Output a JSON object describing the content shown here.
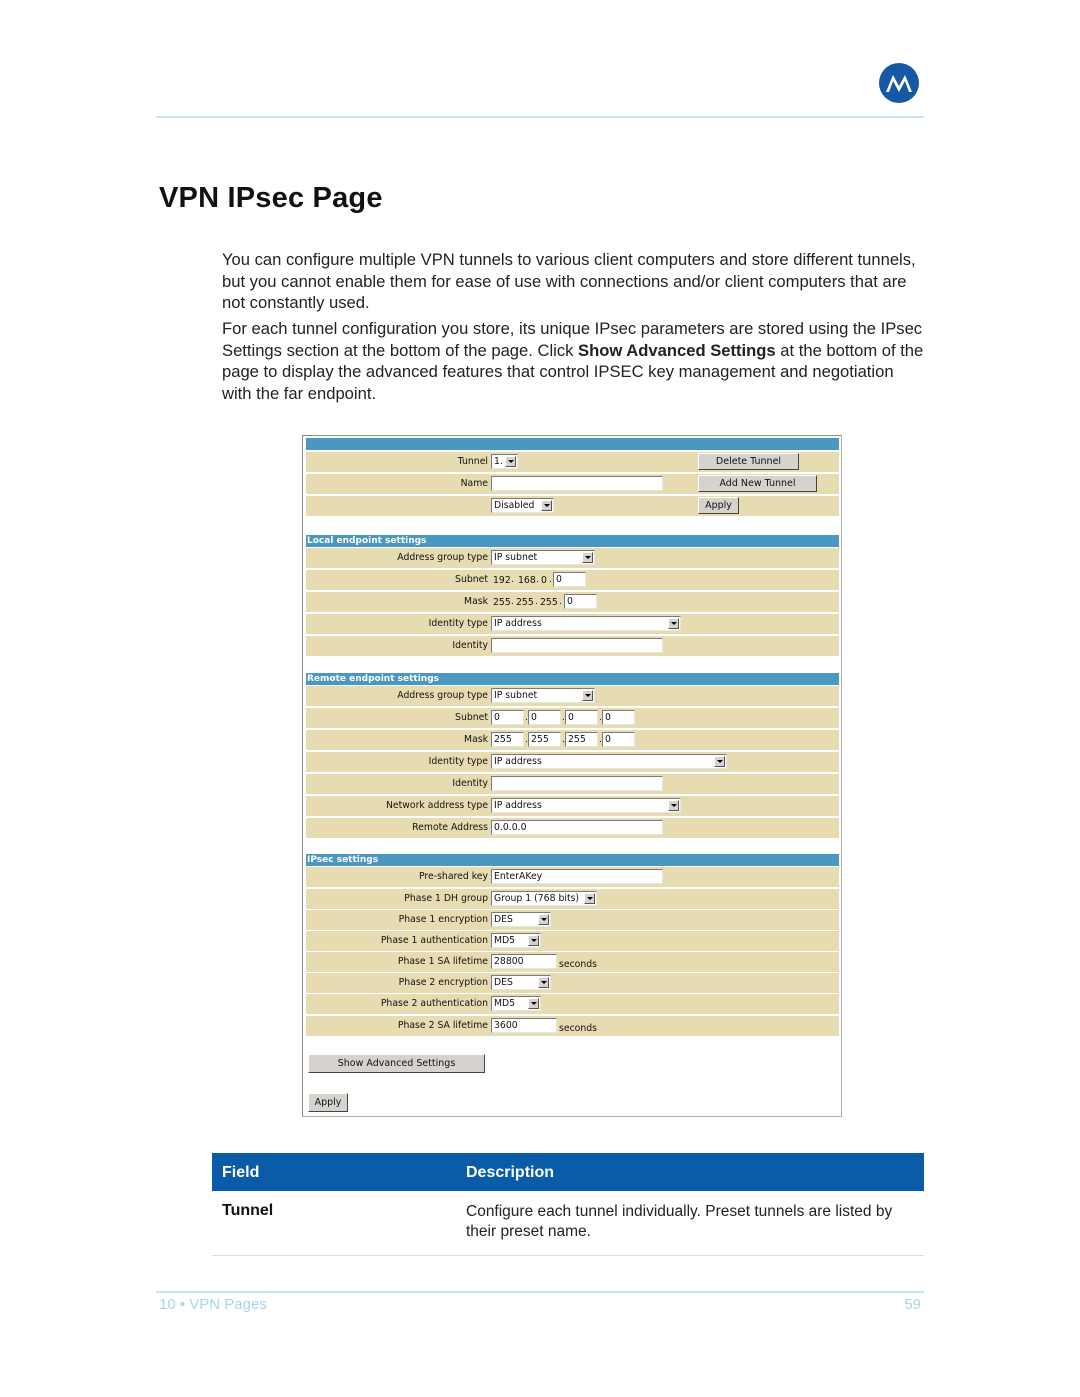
{
  "header": {
    "logo_icon": "motorola-logo-icon"
  },
  "title": "VPN IPsec Page",
  "intro": {
    "p1": "You can configure multiple VPN tunnels to various client computers and store different tunnels, but you cannot enable them for ease of use with connections and/or client computers that are not constantly used.",
    "p2_before": "For each tunnel configuration you store, its unique IPsec parameters are stored using the IPsec Settings section at the bottom of the page. Click ",
    "p2_bold": "Show Advanced Settings",
    "p2_after": " at the bottom of the page to display the advanced features that control IPSEC key management and negotiation with the far endpoint."
  },
  "screenshot": {
    "tunnel": {
      "label": "Tunnel",
      "value": "1."
    },
    "name": {
      "label": "Name",
      "value": ""
    },
    "state": {
      "value": "Disabled"
    },
    "buttons": {
      "delete_tunnel": "Delete Tunnel",
      "add_new_tunnel": "Add New Tunnel",
      "apply_top": "Apply",
      "show_advanced": "Show Advanced Settings",
      "apply_bottom": "Apply"
    },
    "local": {
      "heading": "Local endpoint settings",
      "address_group_type": {
        "label": "Address group type",
        "value": "IP subnet"
      },
      "subnet": {
        "label": "Subnet",
        "fixed": [
          "192",
          "168",
          "0"
        ],
        "last": "0"
      },
      "mask": {
        "label": "Mask",
        "fixed": [
          "255",
          "255",
          "255"
        ],
        "last": "0"
      },
      "identity_type": {
        "label": "Identity type",
        "value": "IP address"
      },
      "identity": {
        "label": "Identity",
        "value": ""
      }
    },
    "remote": {
      "heading": "Remote endpoint settings",
      "address_group_type": {
        "label": "Address group type",
        "value": "IP subnet"
      },
      "subnet": {
        "label": "Subnet",
        "octets": [
          "0",
          "0",
          "0",
          "0"
        ]
      },
      "mask": {
        "label": "Mask",
        "octets": [
          "255",
          "255",
          "255",
          "0"
        ]
      },
      "identity_type": {
        "label": "Identity type",
        "value": "IP address"
      },
      "identity": {
        "label": "Identity",
        "value": ""
      },
      "network_address_type": {
        "label": "Network address type",
        "value": "IP address"
      },
      "remote_address": {
        "label": "Remote Address",
        "value": "0.0.0.0"
      }
    },
    "ipsec": {
      "heading": "IPsec settings",
      "pre_shared_key": {
        "label": "Pre-shared key",
        "value": "EnterAKey"
      },
      "phase1_dh_group": {
        "label": "Phase 1 DH group",
        "value": "Group 1 (768 bits)"
      },
      "phase1_encryption": {
        "label": "Phase 1 encryption",
        "value": "DES"
      },
      "phase1_authentication": {
        "label": "Phase 1 authentication",
        "value": "MD5"
      },
      "phase1_sa_lifetime": {
        "label": "Phase 1 SA lifetime",
        "value": "28800",
        "unit": "seconds"
      },
      "phase2_encryption": {
        "label": "Phase 2 encryption",
        "value": "DES"
      },
      "phase2_authentication": {
        "label": "Phase 2 authentication",
        "value": "MD5"
      },
      "phase2_sa_lifetime": {
        "label": "Phase 2 SA lifetime",
        "value": "3600",
        "unit": "seconds"
      }
    }
  },
  "field_table": {
    "headers": [
      "Field",
      "Description"
    ],
    "rows": [
      {
        "field": "Tunnel",
        "description": "Configure each tunnel individually. Preset tunnels are listed by their preset name."
      }
    ]
  },
  "footer": {
    "section": "10 • VPN Pages",
    "page": "59"
  },
  "colors": {
    "brand_blue": "#0a5ca9",
    "section_header": "#4a97c2",
    "row_bg": "#e7dbb1",
    "rule": "#c6e2f0"
  }
}
